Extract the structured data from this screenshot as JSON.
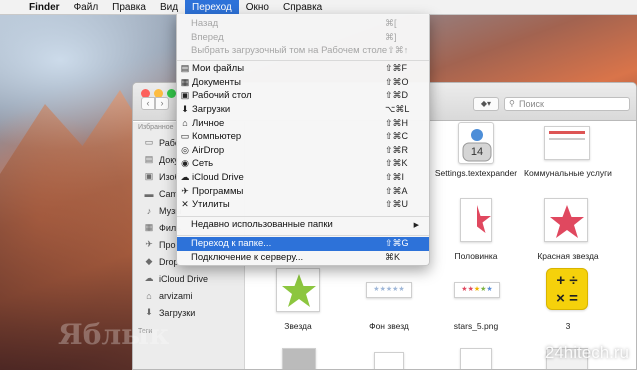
{
  "menubar": {
    "apple": "",
    "items": [
      "Finder",
      "Файл",
      "Правка",
      "Вид",
      "Переход",
      "Окно",
      "Справка"
    ]
  },
  "menu": {
    "disabled": [
      {
        "label": "Назад",
        "shortcut": "⌘["
      },
      {
        "label": "Вперед",
        "shortcut": "⌘]"
      },
      {
        "label": "Выбрать загрузочный том на Рабочем столе",
        "shortcut": "⇧⌘↑"
      }
    ],
    "places": [
      {
        "label": "Мои файлы",
        "shortcut": "⇧⌘F",
        "icon": "all-files-icon"
      },
      {
        "label": "Документы",
        "shortcut": "⇧⌘O",
        "icon": "documents-icon"
      },
      {
        "label": "Рабочий стол",
        "shortcut": "⇧⌘D",
        "icon": "desktop-icon"
      },
      {
        "label": "Загрузки",
        "shortcut": "⌥⌘L",
        "icon": "downloads-icon"
      },
      {
        "label": "Личное",
        "shortcut": "⇧⌘H",
        "icon": "home-icon"
      },
      {
        "label": "Компьютер",
        "shortcut": "⇧⌘C",
        "icon": "computer-icon"
      },
      {
        "label": "AirDrop",
        "shortcut": "⇧⌘R",
        "icon": "airdrop-icon"
      },
      {
        "label": "Сеть",
        "shortcut": "⇧⌘K",
        "icon": "network-icon"
      },
      {
        "label": "iCloud Drive",
        "shortcut": "⇧⌘I",
        "icon": "icloud-icon"
      },
      {
        "label": "Программы",
        "shortcut": "⇧⌘A",
        "icon": "applications-icon"
      },
      {
        "label": "Утилиты",
        "shortcut": "⇧⌘U",
        "icon": "utilities-icon"
      }
    ],
    "recent": {
      "label": "Недавно использованные папки",
      "arrow": "▶"
    },
    "goto": {
      "label": "Переход к папке...",
      "shortcut": "⇧⌘G"
    },
    "connect": {
      "label": "Подключение к серверу...",
      "shortcut": "⌘K"
    }
  },
  "finder": {
    "search_placeholder": "Поиск",
    "sidebar_header_favorites": "Избранное",
    "sidebar_items": [
      {
        "label": "Рабо",
        "icon": "folder-icon"
      },
      {
        "label": "Доку",
        "icon": "documents-icon"
      },
      {
        "label": "Изоб",
        "icon": "folder-icon"
      },
      {
        "label": "Cam",
        "icon": "folder-icon"
      },
      {
        "label": "Музы",
        "icon": "music-icon"
      },
      {
        "label": "Филь",
        "icon": "movies-icon"
      },
      {
        "label": "Прог",
        "icon": "applications-icon"
      },
      {
        "label": "Drop",
        "icon": "dropbox-icon"
      },
      {
        "label": "iCloud Drive",
        "icon": "icloud-icon"
      },
      {
        "label": "arvizami",
        "icon": "home-icon"
      },
      {
        "label": "Загрузки",
        "icon": "downloads-icon"
      }
    ],
    "sidebar_header_tags": "Теги",
    "files": [
      {
        "name": "Settings.textexpander",
        "badge": "14"
      },
      {
        "name": "Коммунальные услуги"
      },
      {
        "name": "Половинка"
      },
      {
        "name": "Красная звезда"
      },
      {
        "name": "Звезда"
      },
      {
        "name": "Фон звезд"
      },
      {
        "name": "stars_5.png"
      },
      {
        "name": "3"
      }
    ]
  },
  "watermarks": {
    "left": "Яблык",
    "right": "24hitech.ru"
  },
  "colors": {
    "highlight": "#2d72d9",
    "star_red": "#e0485f",
    "star_green": "#8cc63f",
    "calc_yellow": "#f5d10b"
  }
}
